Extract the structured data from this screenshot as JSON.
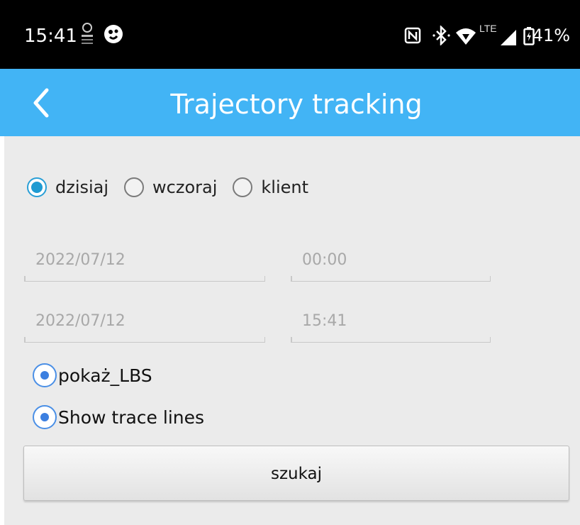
{
  "status_bar": {
    "time": "15:41",
    "battery": "41%",
    "network": "LTE"
  },
  "app_bar": {
    "title": "Trajectory tracking"
  },
  "date_range": {
    "options": [
      {
        "label": "dzisiaj",
        "checked": true
      },
      {
        "label": "wczoraj",
        "checked": false
      },
      {
        "label": "klient",
        "checked": false
      }
    ]
  },
  "fields": {
    "start_date": "2022/07/12",
    "start_time": "00:00",
    "end_date": "2022/07/12",
    "end_time": "15:41"
  },
  "options": {
    "show_lbs_label": "pokaż_LBS",
    "show_lbs_checked": true,
    "show_trace_label": "Show trace lines",
    "show_trace_checked": true
  },
  "search_button": {
    "label": "szukaj"
  },
  "colors": {
    "accent": "#42b4f5",
    "radio": "#1e9bd2",
    "check": "#3c7fe0"
  }
}
